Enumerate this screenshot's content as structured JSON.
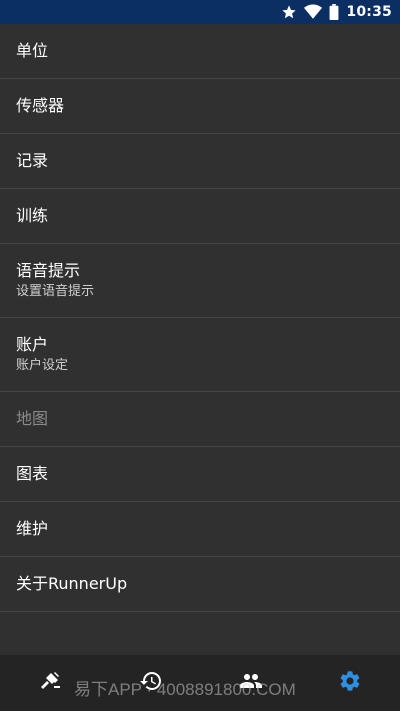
{
  "status_bar": {
    "time": "10:35",
    "icons": [
      "star-icon",
      "wifi-icon",
      "battery-icon"
    ],
    "background": "#0b2f63"
  },
  "settings": {
    "items": [
      {
        "title": "单位",
        "summary": ""
      },
      {
        "title": "传感器",
        "summary": ""
      },
      {
        "title": "记录",
        "summary": ""
      },
      {
        "title": "训练",
        "summary": ""
      },
      {
        "title": "语音提示",
        "summary": "设置语音提示"
      },
      {
        "title": "账户",
        "summary": "账户设定"
      },
      {
        "title": "地图",
        "summary": ""
      },
      {
        "title": "图表",
        "summary": ""
      },
      {
        "title": "维护",
        "summary": ""
      },
      {
        "title": "关于RunnerUp",
        "summary": ""
      }
    ]
  },
  "bottom_nav": {
    "items": [
      {
        "icon": "start-activity-icon"
      },
      {
        "icon": "history-icon"
      },
      {
        "icon": "feed-icon"
      },
      {
        "icon": "settings-gear-icon",
        "active": true
      }
    ],
    "accent": "#2f8fe0"
  },
  "watermark": {
    "text": "易下APP · 4008891800.COM"
  }
}
